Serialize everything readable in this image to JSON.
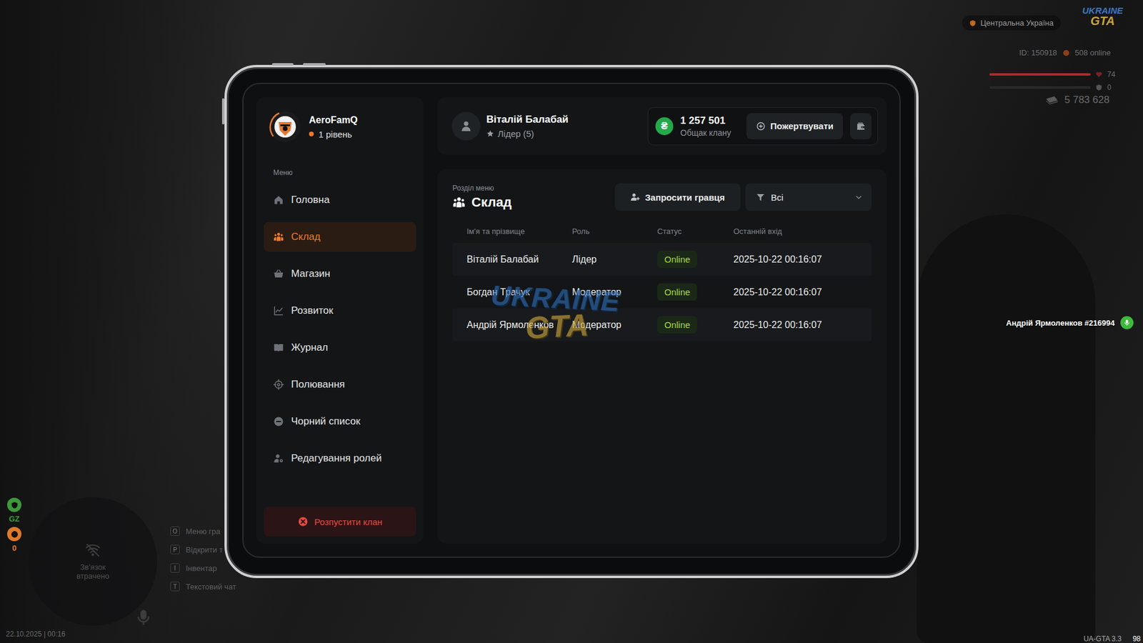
{
  "hud": {
    "region": "Центральна Україна",
    "logo": {
      "top": "UKRAINE",
      "bottom": "GTA"
    },
    "id": "ID: 150918",
    "online": "508 online",
    "health": {
      "reading": "74",
      "level": 1
    },
    "armor": {
      "reading": "0",
      "level": 0
    },
    "money": "5 783 628"
  },
  "nametag": {
    "text": "Андрій Ярмоленков #216994",
    "speaking": true
  },
  "minimap": {
    "text": "Зв'язок втрачено"
  },
  "status_icons": [
    {
      "label": "GZ",
      "color": "#3c9a3a"
    },
    {
      "label": "0",
      "color": "#e07a2a"
    }
  ],
  "hints": [
    {
      "key": "O",
      "label": "Меню гра"
    },
    {
      "key": "P",
      "label": "Відкрити т"
    },
    {
      "key": "I",
      "label": "Інвентар"
    },
    {
      "key": "T",
      "label": "Текстовий чат"
    }
  ],
  "clock": "22.10.2025 | 00:16",
  "version": "UA-GTA 3.3",
  "fps": "98",
  "tablet": {
    "clan": {
      "name": "AeroFamQ",
      "level": "1 рівень"
    },
    "menu_title": "Меню",
    "menu": [
      {
        "label": "Головна",
        "selected": false
      },
      {
        "label": "Склад",
        "selected": true
      },
      {
        "label": "Магазин",
        "selected": false
      },
      {
        "label": "Розвиток",
        "selected": false
      },
      {
        "label": "Журнал",
        "selected": false
      },
      {
        "label": "Полювання",
        "selected": false
      },
      {
        "label": "Чорний список",
        "selected": false
      },
      {
        "label": "Редагування ролей",
        "selected": false
      }
    ],
    "disband": "Розпустити клан",
    "user": {
      "name": "Віталій Балабай",
      "rank": "Лідер (5)"
    },
    "bank": {
      "currency": "₴",
      "amount": "1 257 501",
      "label": "Общак клану"
    },
    "donate": "Пожертвувати",
    "section_caption": "Розділ меню",
    "section_title": "Склад",
    "invite": "Запросити гравця",
    "filter": "Всі",
    "table": {
      "columns": [
        "Ім'я та прізвище",
        "Роль",
        "Статус",
        "Останній вхід"
      ],
      "rows": [
        {
          "name": "Віталій Балабай",
          "role": "Лідер",
          "status": "Online",
          "online": true,
          "last": "2025-10-22 00:16:07"
        },
        {
          "name": "Богдан Трачук",
          "role": "Модератор",
          "status": "Online",
          "online": true,
          "last": "2025-10-22 00:16:07"
        },
        {
          "name": "Андрій Ярмоленков",
          "role": "Модератор",
          "status": "Online",
          "online": true,
          "last": "2025-10-22 00:16:07"
        }
      ]
    },
    "watermark": {
      "top": "UKRAINE",
      "bottom": "GTA"
    }
  }
}
